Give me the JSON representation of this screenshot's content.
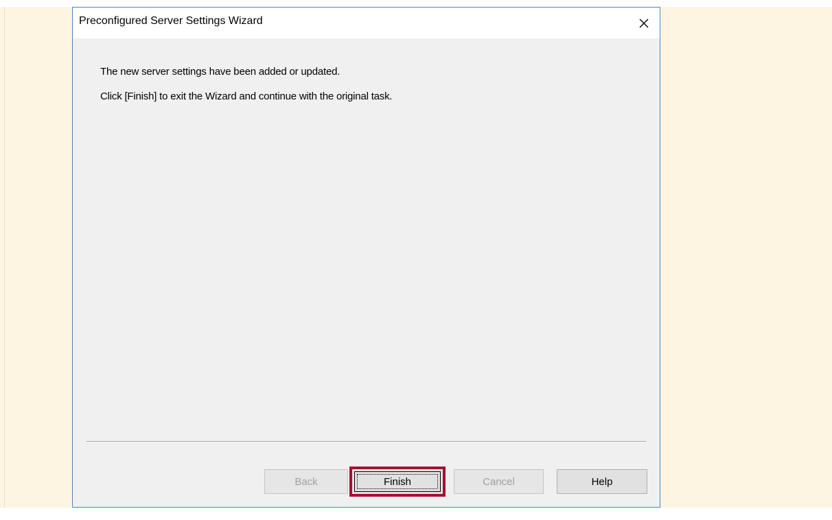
{
  "dialog": {
    "title": "Preconfigured Server Settings Wizard",
    "close_icon": "close-icon"
  },
  "content": {
    "line1": "The new server settings have been added or updated.",
    "line2": "Click [Finish] to exit the Wizard and continue with the original task."
  },
  "buttons": {
    "back": "Back",
    "finish": "Finish",
    "cancel": "Cancel",
    "help": "Help"
  },
  "states": {
    "back_enabled": false,
    "finish_enabled": true,
    "cancel_enabled": false,
    "help_enabled": true
  },
  "colors": {
    "page_background": "#fdf5e2",
    "dialog_border": "#4a83cc",
    "highlight": "#a31230"
  }
}
